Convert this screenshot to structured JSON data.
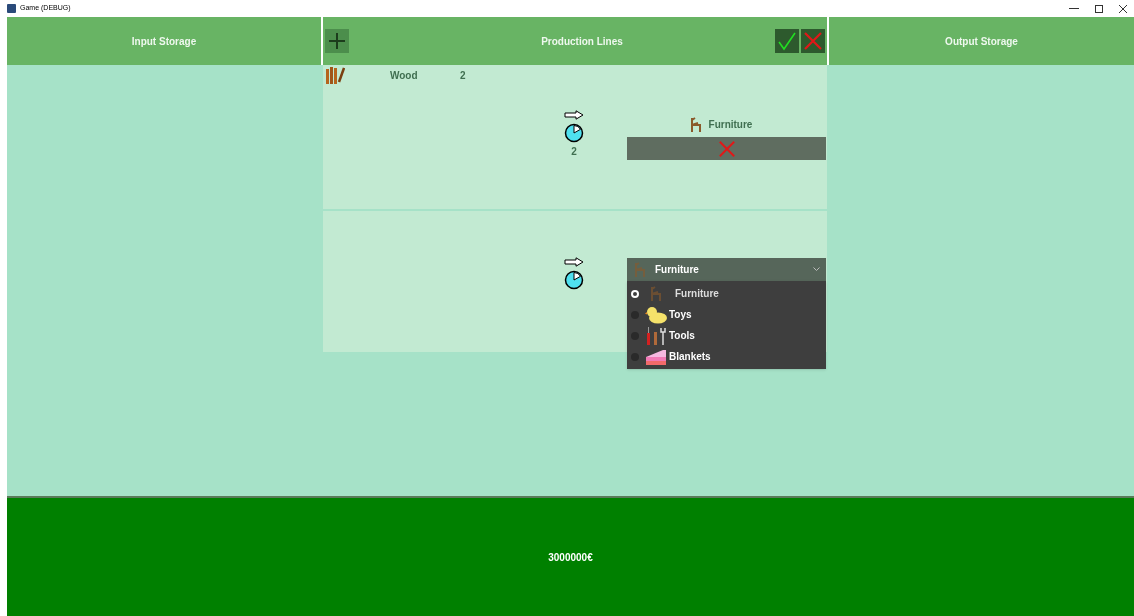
{
  "window": {
    "title": "Game (DEBUG)"
  },
  "panels": {
    "input_title": "Input Storage",
    "lines_title": "Production Lines",
    "output_title": "Output Storage"
  },
  "lines": [
    {
      "kind": "set",
      "inputs": [
        {
          "name": "Wood",
          "amount": "2"
        }
      ],
      "time": "2",
      "output": "Furniture"
    },
    {
      "kind": "choosing",
      "dropdown": {
        "value": "Furniture",
        "expanded": true,
        "options": [
          {
            "label": "Furniture",
            "selected": true
          },
          {
            "label": "Toys",
            "selected": false
          },
          {
            "label": "Tools",
            "selected": false
          },
          {
            "label": "Blankets",
            "selected": false
          }
        ]
      }
    }
  ],
  "status_bar": {
    "money": "3000000€"
  }
}
